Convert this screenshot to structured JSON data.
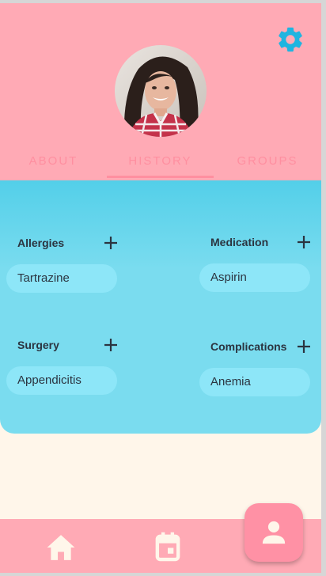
{
  "tabs": [
    {
      "label": "ABOUT"
    },
    {
      "label": "HISTORY"
    },
    {
      "label": "GROUPS"
    }
  ],
  "active_tab": "HISTORY",
  "sections": {
    "allergies": {
      "title": "Allergies",
      "item": "Tartrazine"
    },
    "medication": {
      "title": "Medication",
      "item": "Aspirin"
    },
    "surgery": {
      "title": "Surgery",
      "item": "Appendicitis"
    },
    "complications": {
      "title": "Complications",
      "item": "Anemia"
    }
  },
  "icons": {
    "settings": "gear-icon",
    "add": "plus-icon",
    "home": "home-icon",
    "calendar": "calendar-icon",
    "profile": "person-icon"
  },
  "colors": {
    "header": "#ffaab5",
    "accent_tab": "#ff8fa0",
    "panel": "#7adcef",
    "chip": "#8de6f8",
    "gear": "#1fb5e0",
    "background": "#fff6ea",
    "fab": "#ff91a5"
  }
}
